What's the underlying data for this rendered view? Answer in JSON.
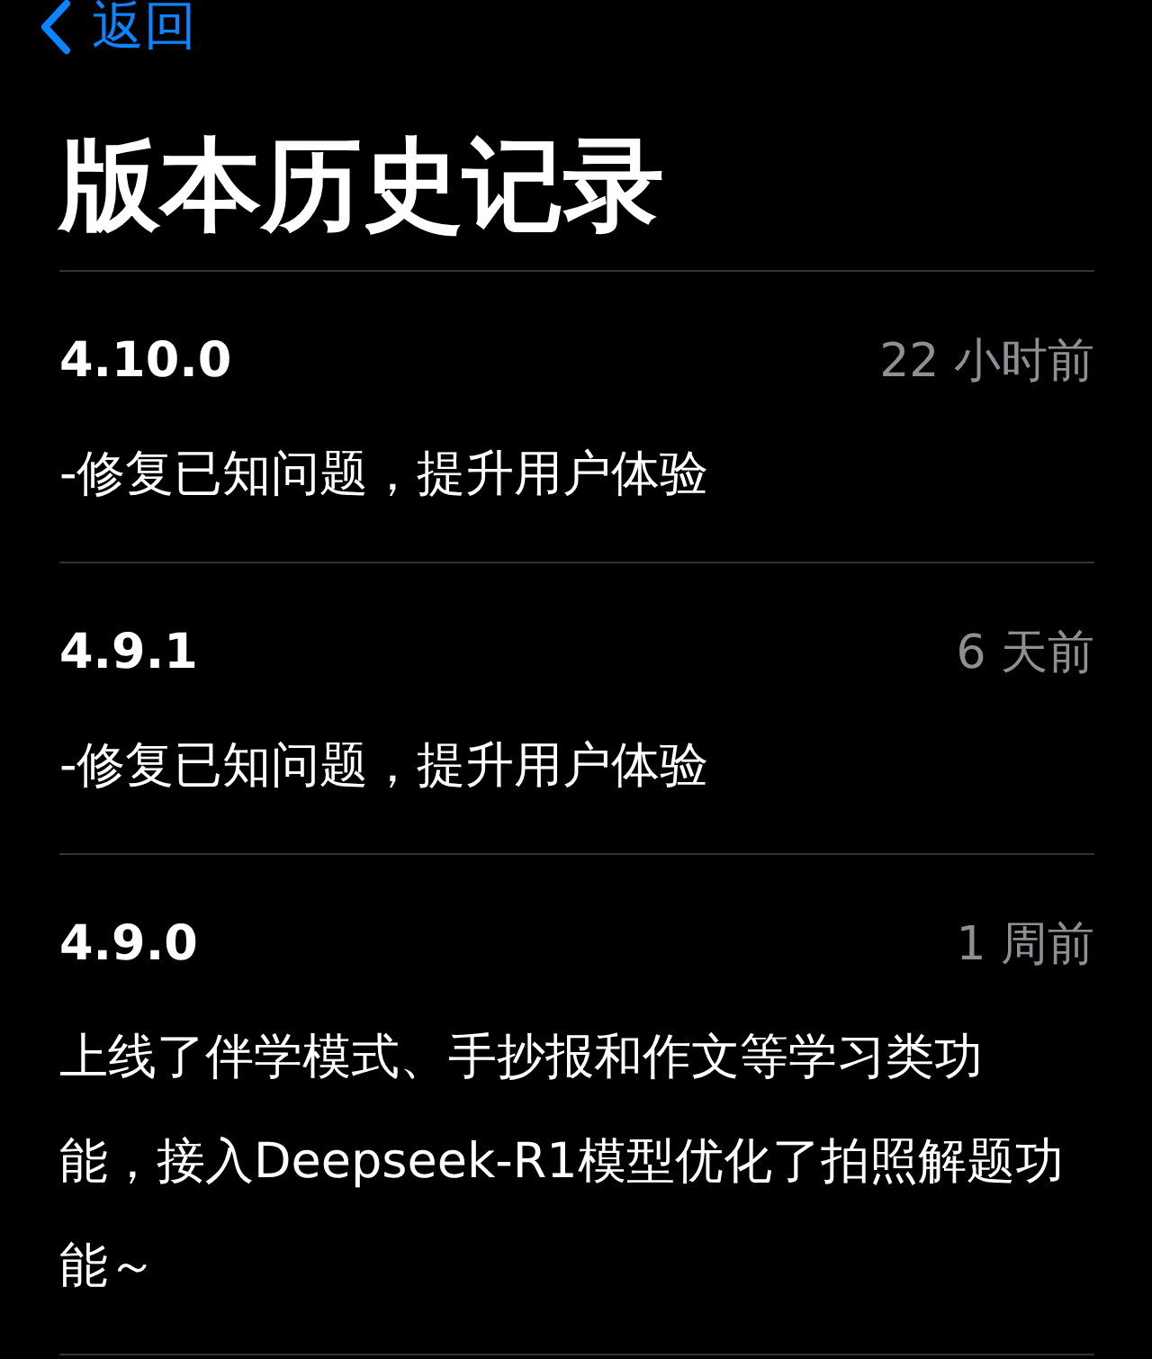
{
  "nav": {
    "back_label": "返回"
  },
  "title": "版本历史记录",
  "versions": [
    {
      "version": "4.10.0",
      "time": "22 小时前",
      "notes": "-修复已知问题，提升用户体验"
    },
    {
      "version": "4.9.1",
      "time": "6 天前",
      "notes": "-修复已知问题，提升用户体验"
    },
    {
      "version": "4.9.0",
      "time": "1 周前",
      "notes": "上线了伴学模式、手抄报和作文等学习类功能，接入Deepseek-R1模型优化了拍照解题功能～"
    }
  ]
}
